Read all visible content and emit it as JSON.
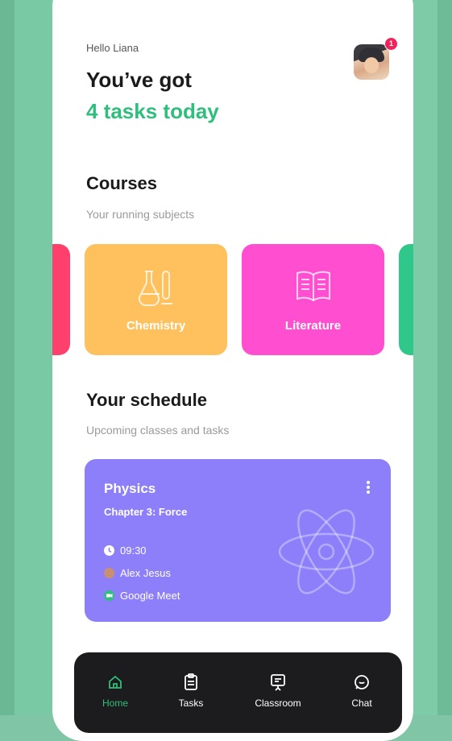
{
  "header": {
    "greeting": "Hello Liana",
    "line1": "You’ve got",
    "line2": "4 tasks today",
    "notification_count": "1"
  },
  "courses": {
    "title": "Courses",
    "subtitle": "Your running subjects",
    "items": [
      {
        "label": "Chemistry",
        "color": "#ffc15e",
        "icon": "flask-icon"
      },
      {
        "label": "Literature",
        "color": "#ff4fd0",
        "icon": "book-icon"
      }
    ]
  },
  "schedule": {
    "title": "Your schedule",
    "subtitle": "Upcoming classes and tasks",
    "card": {
      "subject": "Physics",
      "chapter": "Chapter 3: Force",
      "time": "09:30",
      "teacher": "Alex Jesus",
      "platform": "Google Meet",
      "color": "#8c7ff9"
    }
  },
  "nav": {
    "items": [
      {
        "label": "Home",
        "icon": "home-icon",
        "active": true
      },
      {
        "label": "Tasks",
        "icon": "clipboard-icon",
        "active": false
      },
      {
        "label": "Classroom",
        "icon": "presentation-icon",
        "active": false
      },
      {
        "label": "Chat",
        "icon": "chat-icon",
        "active": false
      }
    ],
    "active_color": "#2fbf7c"
  }
}
